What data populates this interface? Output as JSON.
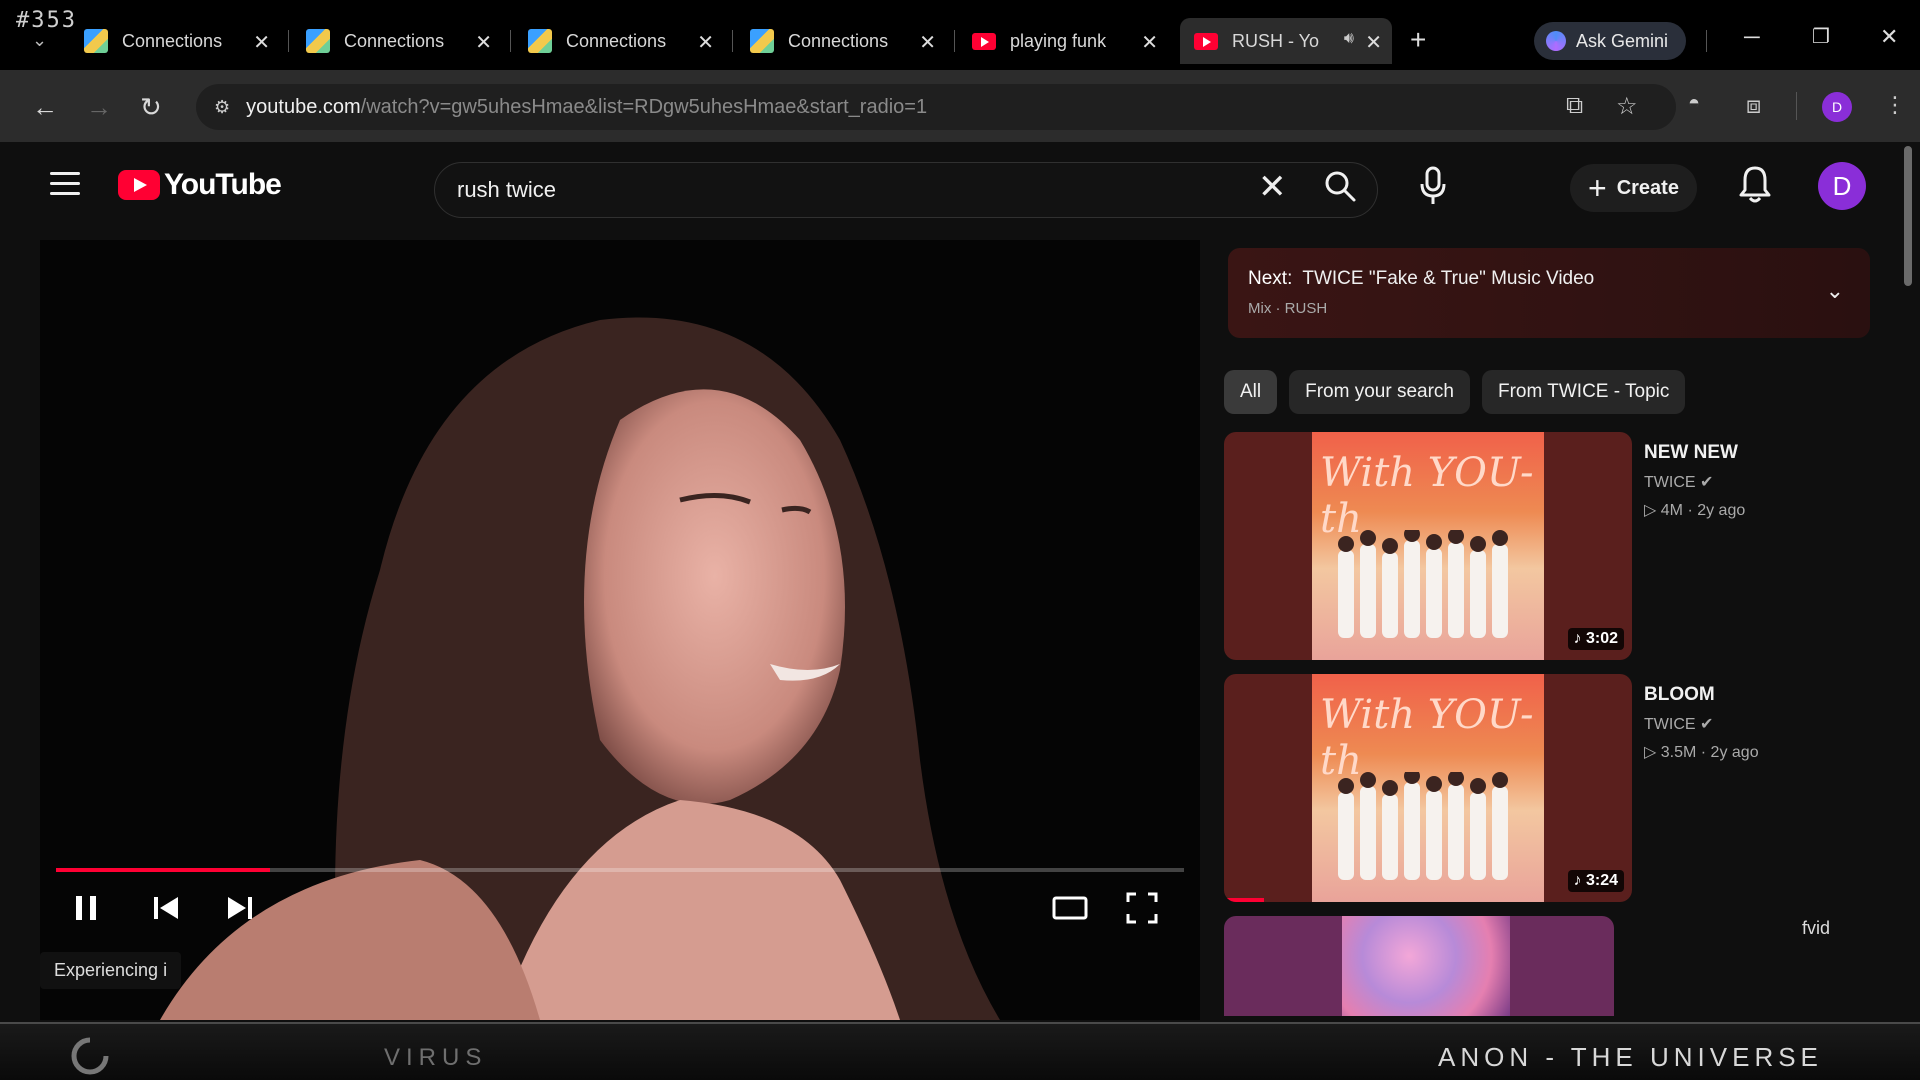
{
  "overlay": {
    "corner_number": "#353"
  },
  "tabs": [
    {
      "title": "Connections",
      "favicon": "connections-icon"
    },
    {
      "title": "Connections",
      "favicon": "connections-icon"
    },
    {
      "title": "Connections",
      "favicon": "connections-icon"
    },
    {
      "title": "Connections",
      "favicon": "connections-icon"
    },
    {
      "title": "playing funk",
      "favicon": "youtube-icon"
    },
    {
      "title": "RUSH - Yo",
      "favicon": "youtube-icon",
      "active": true
    }
  ],
  "browser": {
    "ask_gemini": "Ask Gemini",
    "url_host": "youtube.com",
    "url_path": "/watch?v=gw5uhesHmae&list=RDgw5uhesHmae&start_radio=1",
    "profile_initial": "D"
  },
  "youtube": {
    "logo_text": "YouTube",
    "search_value": "rush twice",
    "search_placeholder": "Search",
    "create_label": "Create",
    "avatar_initial": "D"
  },
  "player": {
    "progress_fraction": 0.19,
    "toast": "Experiencing i"
  },
  "up_next": {
    "label": "Next:",
    "title": "TWICE \"Fake & True\" Music Video",
    "subtitle": "Mix · RUSH"
  },
  "chips": [
    {
      "label": "All",
      "active": true
    },
    {
      "label": "From your search",
      "active": false
    },
    {
      "label": "From TWICE - Topic",
      "active": false
    }
  ],
  "recommendations": [
    {
      "title": "NEW NEW",
      "channel": "TWICE",
      "meta": "4M · 2y ago",
      "duration": "3:02",
      "art_text": "With YOU-th"
    },
    {
      "title": "BLOOM",
      "channel": "TWICE",
      "meta": "3.5M · 2y ago",
      "duration": "3:24",
      "art_text": "With YOU-th"
    }
  ],
  "side_label": "fvid",
  "banner": {
    "left_word": "VIRUS",
    "right_word": "ANON - THE UNIVERSE"
  },
  "colors": {
    "yt_red": "#ff0033",
    "avatar_purple": "#8a2ed8"
  }
}
